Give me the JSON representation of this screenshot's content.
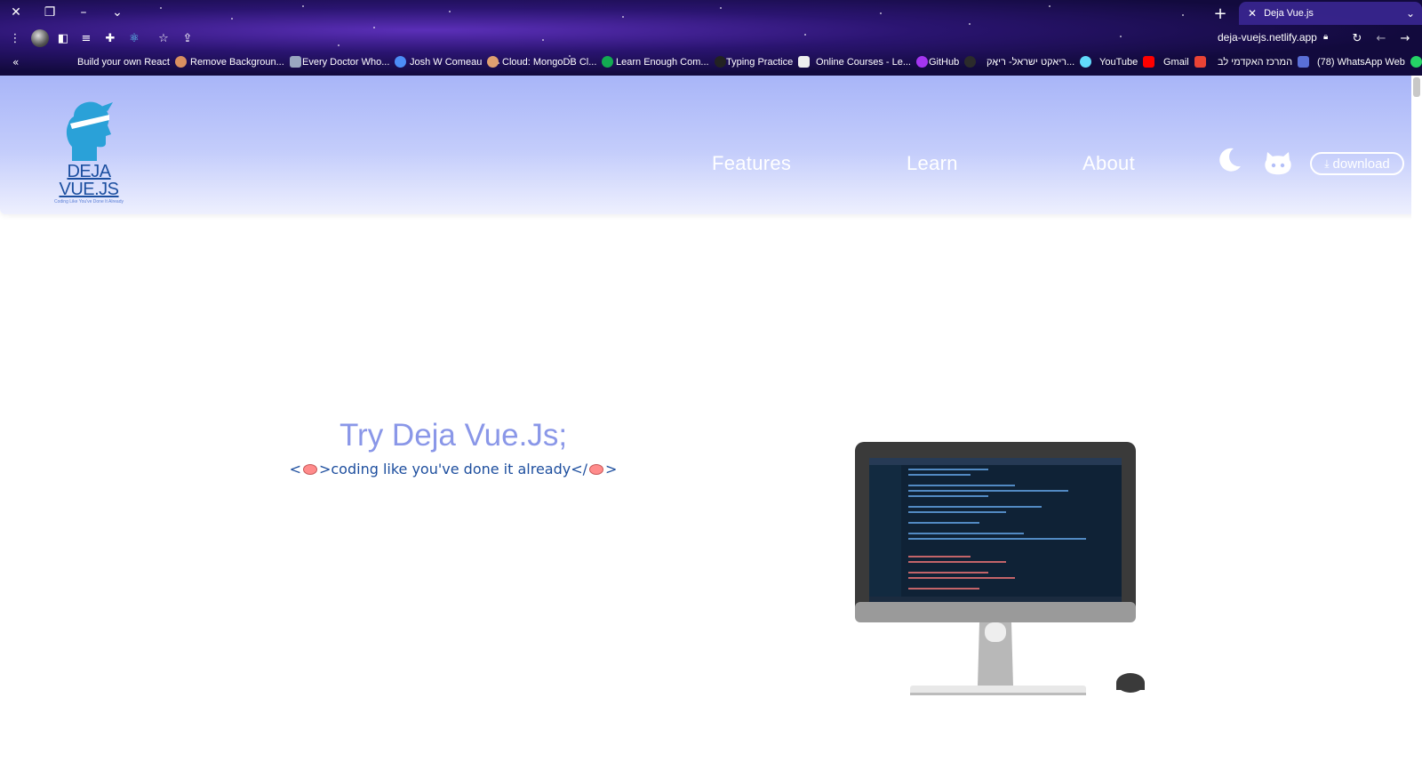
{
  "browser": {
    "tab_title": "Deja Vue.js",
    "url": "deja-vuejs.netlify.app",
    "bookmarks": [
      "Build your own React",
      "Remove Backgroun...",
      "Every Doctor Who...",
      "Josh W Comeau",
      "Cloud: MongoDB Cl...",
      "Learn Enough Com...",
      "Typing Practice",
      "Online Courses - Le...",
      "GitHub",
      "ריאקט ישראל- ריאק...",
      "YouTube",
      "Gmail",
      "המרכז האקדמי לב",
      "(78) WhatsApp Web"
    ]
  },
  "site": {
    "logo_title": "DEJA VUE.JS",
    "logo_tagline": "Coding Like You've Done It Already",
    "nav": [
      "Features",
      "Learn",
      "About"
    ],
    "download_label": "download",
    "hero_title": "Try Deja Vue.Js;",
    "hero_sub_open": "<",
    "hero_sub_mid": ">coding like you've done it already</",
    "hero_sub_close": ">"
  },
  "colors": {
    "header_top": "#a8b5f8",
    "hero_title": "#8a97e8",
    "hero_sub": "#1d4e9e",
    "logo": "#2aa1d8"
  }
}
